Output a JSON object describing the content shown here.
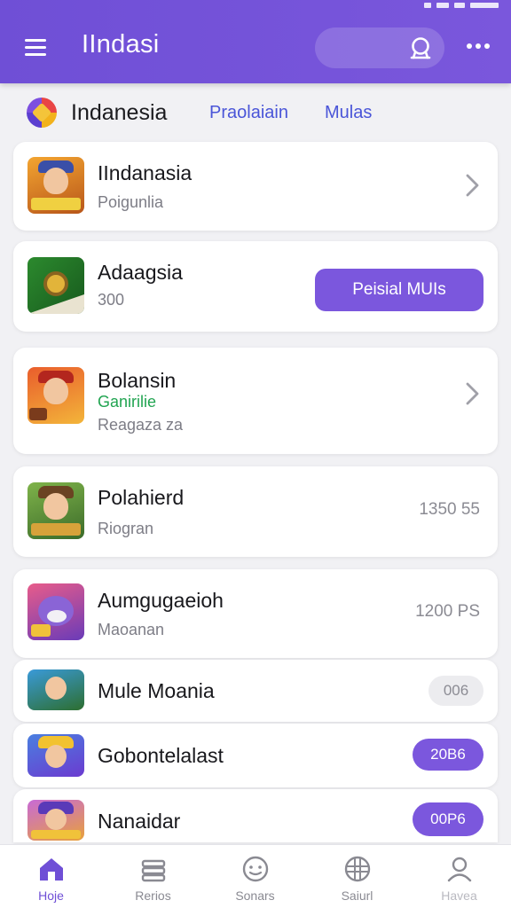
{
  "app": {
    "title": "IIndasi"
  },
  "filter": {
    "region": "Indanesia",
    "tabs": [
      "Praolaiain",
      "Mulas"
    ]
  },
  "cards": [
    {
      "title": "IIndanasia",
      "subtitle": "Poigunlia"
    },
    {
      "title": "Adaagsia",
      "subtitle": "300",
      "button": "Peisial MUIs"
    },
    {
      "title": "Bolansin",
      "green": "Ganirilie",
      "subtitle": "Reagaza za"
    },
    {
      "title": "Polahierd",
      "subtitle": "Riogran",
      "price": "1350 55"
    },
    {
      "title": "Aumgugaeioh",
      "subtitle": "Maoanan",
      "price": "1200 PS"
    },
    {
      "title": "Mule Moania",
      "pill": "006"
    },
    {
      "title": "Gobontelalast",
      "pill": "20B6"
    },
    {
      "title": "Nanaidar",
      "pill": "00P6"
    }
  ],
  "nav": [
    {
      "label": "Hoje"
    },
    {
      "label": "Rerios"
    },
    {
      "label": "Sonars"
    },
    {
      "label": "Saiurl"
    },
    {
      "label": "Havea"
    }
  ],
  "colors": {
    "accent": "#7b57dd",
    "header": "#6f4fd6",
    "green": "#21a451"
  }
}
